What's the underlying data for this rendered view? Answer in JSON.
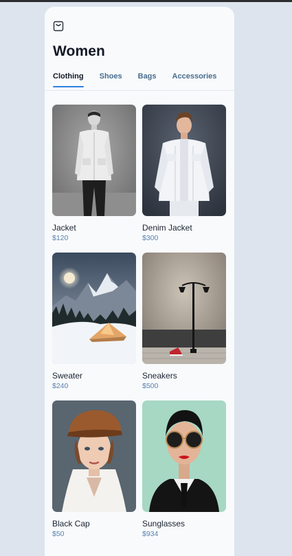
{
  "header": {
    "title": "Women"
  },
  "icons": {
    "cart": "shopping-bag-icon"
  },
  "tabs": [
    {
      "label": "Clothing",
      "active": true
    },
    {
      "label": "Shoes"
    },
    {
      "label": "Bags"
    },
    {
      "label": "Accessories"
    }
  ],
  "products": [
    {
      "name": "Jacket",
      "price": "$120",
      "image": "man-white-jacket-photo"
    },
    {
      "name": "Denim Jacket",
      "price": "$300",
      "image": "man-white-denim-jacket-photo"
    },
    {
      "name": "Sweater",
      "price": "$240",
      "image": "mountain-tent-night-photo"
    },
    {
      "name": "Sneakers",
      "price": "$500",
      "image": "street-lamp-red-sneakers-photo"
    },
    {
      "name": "Black Cap",
      "price": "$50",
      "image": "woman-leather-cap-photo"
    },
    {
      "name": "Sunglasses",
      "price": "$934",
      "image": "woman-round-sunglasses-photo"
    }
  ],
  "colors": {
    "accent": "#2f7fe0",
    "price": "#5a80ad",
    "tab": "#4a6d8e"
  }
}
